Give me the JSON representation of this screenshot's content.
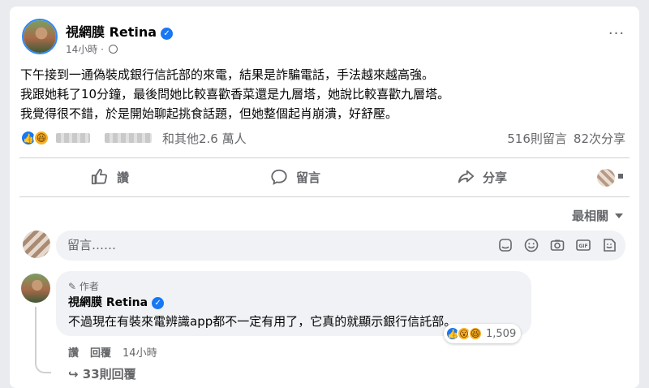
{
  "post": {
    "author": "視網膜 Retina",
    "verified_icon": "verified-badge-icon",
    "time": "14小時",
    "time_separator": "·",
    "privacy_icon": "globe-icon",
    "more_label": "···",
    "lines": [
      "下午接到一通偽裝成銀行信託部的來電，結果是詐騙電話，手法越來越高強。",
      "我跟她耗了10分鐘，最後問她比較喜歡香菜還是九層塔，她說比較喜歡九層塔。",
      "我覺得很不錯，於是開始聊起挑食話題，但她整個起肖崩潰，好舒壓。"
    ]
  },
  "reactions": {
    "types": [
      "like",
      "haha"
    ],
    "others_text": "和其他2.6 萬人",
    "comments_count": "516則留言",
    "shares_count": "82次分享"
  },
  "actions": {
    "like": "讚",
    "comment": "留言",
    "share": "分享"
  },
  "sort": {
    "label": "最相關"
  },
  "composer": {
    "placeholder": "留言……",
    "icons": [
      "sticker-icon",
      "emoji-icon",
      "camera-icon",
      "gif-icon",
      "avatar-sticker-icon"
    ]
  },
  "comment": {
    "badge": "作者",
    "author": "視網膜 Retina",
    "text": "不過現在有裝來電辨識app都不一定有用了，它真的就顯示銀行信託部。",
    "reaction_count": "1,509",
    "like_label": "讚",
    "reply_label": "回覆",
    "time": "14小時",
    "replies_label": "33則回覆"
  },
  "colors": {
    "accent": "#1877f2",
    "secondary_text": "#65676b",
    "bubble": "#f0f2f5"
  }
}
